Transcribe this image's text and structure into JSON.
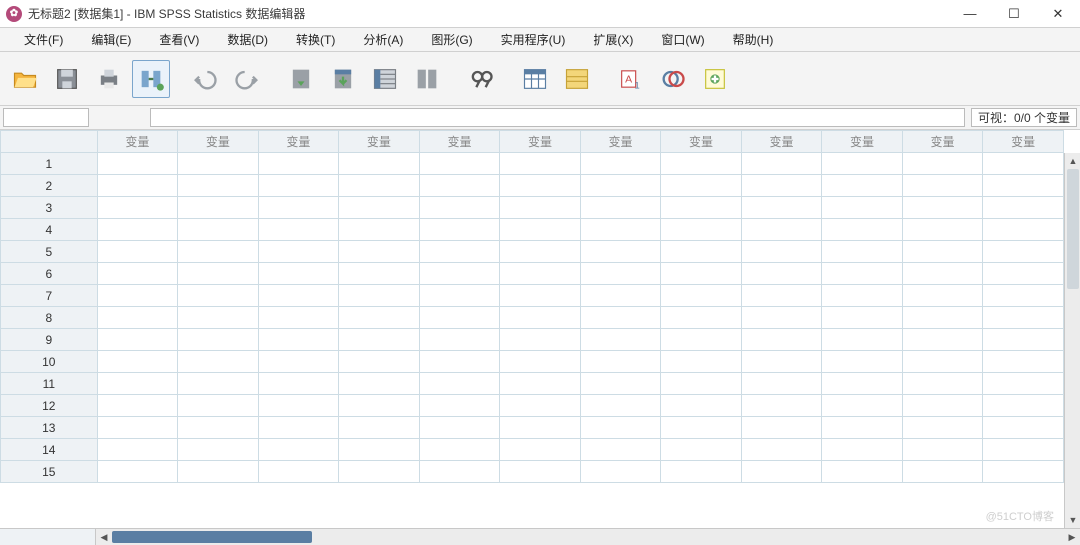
{
  "window": {
    "title": "无标题2 [数据集1] - IBM SPSS Statistics 数据编辑器",
    "minimize": "—",
    "maximize": "☐",
    "close": "✕"
  },
  "menu": {
    "items": [
      "文件(F)",
      "编辑(E)",
      "查看(V)",
      "数据(D)",
      "转换(T)",
      "分析(A)",
      "图形(G)",
      "实用程序(U)",
      "扩展(X)",
      "窗口(W)",
      "帮助(H)"
    ]
  },
  "toolbar": {
    "icons": [
      "open",
      "save",
      "print",
      "recent",
      "undo",
      "redo",
      "goto",
      "vars",
      "compute",
      "chart",
      "weight",
      "find",
      "select",
      "split",
      "valuelabels",
      "addvar",
      "pivot",
      "add"
    ]
  },
  "status": {
    "visible_label": "可视：0/0 个变量"
  },
  "grid": {
    "col_header": "变量",
    "n_cols": 12,
    "n_rows": 15
  },
  "watermark": "@51CTO博客"
}
